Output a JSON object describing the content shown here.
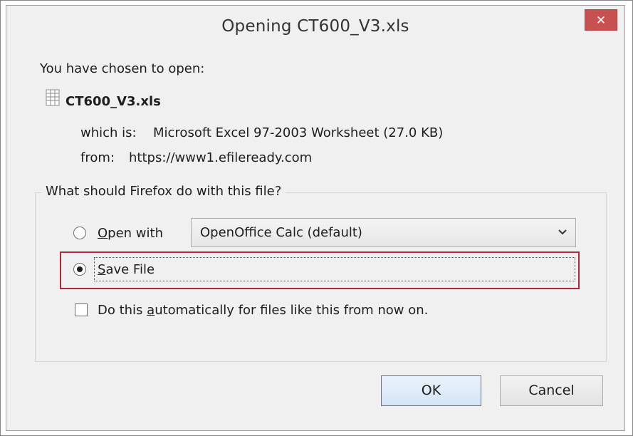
{
  "dialog": {
    "title": "Opening CT600_V3.xls",
    "close_icon": "close-icon"
  },
  "intro": {
    "label": "You have chosen to open:"
  },
  "file": {
    "icon": "spreadsheet-file-icon",
    "name": "CT600_V3.xls",
    "which_is_label": "which is:",
    "which_is_value": "Microsoft Excel 97-2003 Worksheet (27.0 KB)",
    "from_label": "from:",
    "from_value": "https://www1.efileready.com"
  },
  "action_group": {
    "legend": "What should Firefox do with this file?",
    "open_with": {
      "label_prefix": "",
      "label_accel": "O",
      "label_rest": "pen with",
      "selected": false,
      "app_select_value": "OpenOffice Calc (default)"
    },
    "save_file": {
      "label_accel": "S",
      "label_rest": "ave File",
      "selected": true
    },
    "auto_checkbox": {
      "label_prefix": "Do this ",
      "label_accel": "a",
      "label_rest": "utomatically for files like this from now on.",
      "checked": false
    }
  },
  "buttons": {
    "ok_label": "OK",
    "cancel_label": "Cancel"
  },
  "colors": {
    "close_button": "#c75050",
    "highlight_border": "#b0273a",
    "window_bg": "#f0f0f0"
  }
}
